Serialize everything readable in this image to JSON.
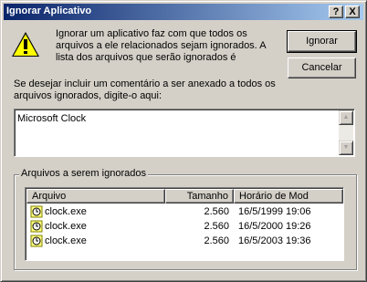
{
  "window": {
    "title": "Ignorar Aplicativo",
    "help_label": "?",
    "close_label": "X"
  },
  "message": "Ignorar um aplicativo faz com que todos os arquivos a ele relacionados sejam ignorados. A lista dos arquivos que serão ignorados é",
  "buttons": {
    "ignore": "Ignorar",
    "cancel": "Cancelar"
  },
  "comment": {
    "label": "Se desejar incluir um comentário a ser anexado a todos os arquivos ignorados, digite-o aqui:",
    "value": "Microsoft Clock"
  },
  "files_group": {
    "label": "Arquivos a serem ignorados",
    "columns": [
      "Arquivo",
      "Tamanho",
      "Horário de Mod"
    ],
    "rows": [
      {
        "name": "clock.exe",
        "size": "2.560",
        "modified": "16/5/1999 19:06"
      },
      {
        "name": "clock.exe",
        "size": "2.560",
        "modified": "16/5/2000 19:26"
      },
      {
        "name": "clock.exe",
        "size": "2.560",
        "modified": "16/5/2003 19:36"
      }
    ]
  },
  "icons": {
    "warning": "warning-icon",
    "file": "clock-file-icon"
  },
  "colors": {
    "title_start": "#0a246a",
    "title_end": "#a6caf0",
    "face": "#d4d0c8"
  }
}
